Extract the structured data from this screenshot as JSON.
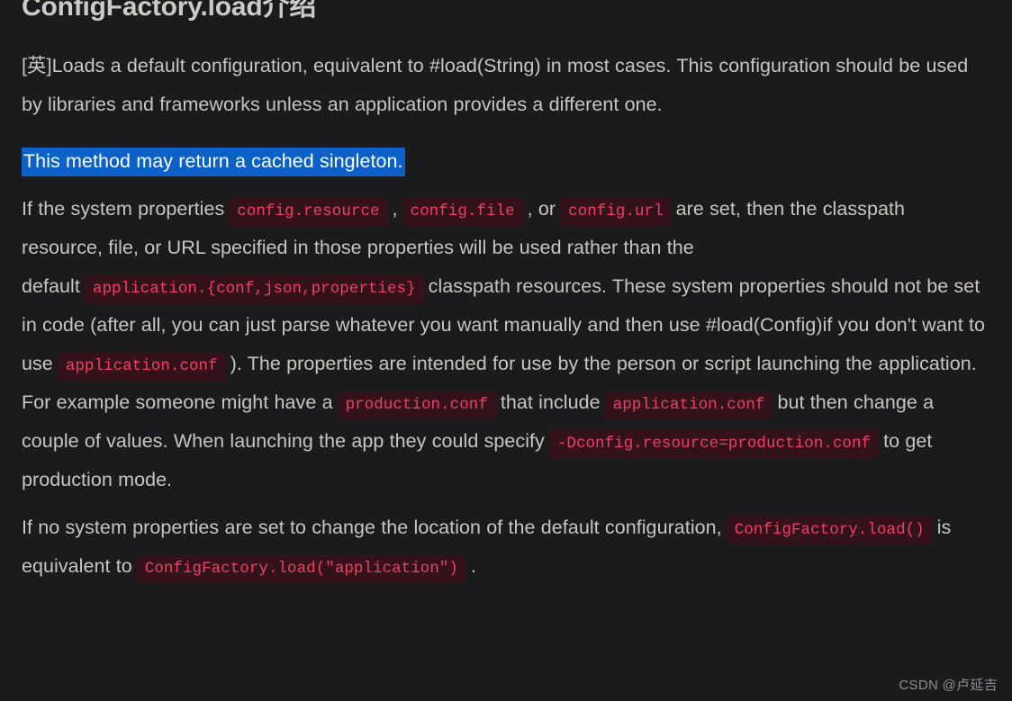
{
  "article": {
    "title": "ConfigFactory.load介绍",
    "paragraph_1": {
      "text": "[英]Loads a default configuration, equivalent to #load(String) in most cases. This configuration should be used by libraries and frameworks unless an application provides a different one."
    },
    "highlighted_sentence": "This method may return a cached singleton.",
    "paragraph_3": {
      "segment_1": "If the system properties",
      "code_1": "config.resource",
      "segment_2": ",",
      "code_2": "config.file",
      "segment_3": ", or",
      "code_3": "config.url",
      "segment_4": "are set, then the classpath resource, file, or URL specified in those properties will be used rather than the default",
      "code_4": "application.{conf,json,properties}",
      "segment_5": "classpath resources. These system properties should not be set in code (after all, you can just parse whatever you want manually and then use #load(Config)if you don't want to use",
      "code_5": "application.conf",
      "segment_6": "). The properties are intended for use by the person or script launching the application. For example someone might have a",
      "code_6": "production.conf",
      "segment_7": "that include",
      "code_7": "application.conf",
      "segment_8": "but then change a couple of values. When launching the app they could specify",
      "code_8": "-Dconfig.resource=production.conf",
      "segment_9": "to get production mode."
    },
    "paragraph_4": {
      "segment_1": "If no system properties are set to change the location of the default configuration,",
      "code_1": "ConfigFactory.load()",
      "segment_2": "is equivalent to",
      "code_2": "ConfigFactory.load(\"application\")",
      "segment_3": "."
    }
  },
  "watermark": {
    "text": "CSDN @卢延吉"
  },
  "theme": {
    "background": "#1b1b1d",
    "body_text": "#c8c5c0",
    "title_text": "#cdc9c5",
    "code_background": "#34121a",
    "code_text": "#ef3f68",
    "highlight_background": "#0c61c9",
    "highlight_text": "#ffffff",
    "watermark_text": "#8e8e92"
  }
}
